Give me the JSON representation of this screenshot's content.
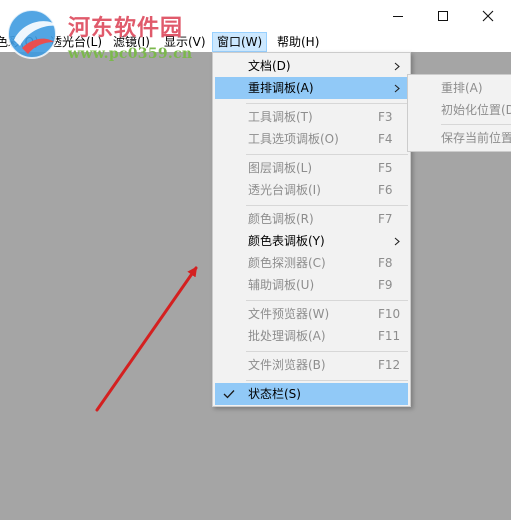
{
  "watermark": {
    "site_name": "河东软件园",
    "url": "www.pc0359.cn"
  },
  "window_controls": {
    "minimize_icon": "minimize-icon",
    "maximize_icon": "maximize-icon",
    "close_icon": "close-icon"
  },
  "menubar": {
    "items": [
      {
        "label": "色彩(O)"
      },
      {
        "label": "透光台(L)"
      },
      {
        "label": "滤镜(I)"
      },
      {
        "label": "显示(V)"
      },
      {
        "label": "窗口(W)"
      },
      {
        "label": "帮助(H)"
      }
    ]
  },
  "window_menu": {
    "items": [
      {
        "label": "文档(D)",
        "shortcut": "",
        "submenu": true,
        "enabled": true
      },
      {
        "label": "重排调板(A)",
        "shortcut": "",
        "submenu": true,
        "enabled": true,
        "highlighted": true
      },
      {
        "label": "工具调板(T)",
        "shortcut": "F3",
        "enabled": false
      },
      {
        "label": "工具选项调板(O)",
        "shortcut": "F4",
        "enabled": false
      },
      {
        "label": "图层调板(L)",
        "shortcut": "F5",
        "enabled": false
      },
      {
        "label": "透光台调板(I)",
        "shortcut": "F6",
        "enabled": false
      },
      {
        "label": "颜色调板(R)",
        "shortcut": "F7",
        "enabled": false
      },
      {
        "label": "颜色表调板(Y)",
        "shortcut": "",
        "submenu": true,
        "enabled": true
      },
      {
        "label": "颜色探测器(C)",
        "shortcut": "F8",
        "enabled": false
      },
      {
        "label": "辅助调板(U)",
        "shortcut": "F9",
        "enabled": false
      },
      {
        "label": "文件预览器(W)",
        "shortcut": "F10",
        "enabled": false
      },
      {
        "label": "批处理调板(A)",
        "shortcut": "F11",
        "enabled": false
      },
      {
        "label": "文件浏览器(B)",
        "shortcut": "F12",
        "enabled": false
      },
      {
        "label": "状态栏(S)",
        "shortcut": "",
        "enabled": true,
        "checked": true
      }
    ]
  },
  "arrange_submenu": {
    "items": [
      {
        "label": "重排(A)",
        "enabled": false
      },
      {
        "label": "初始化位置(D",
        "enabled": false
      },
      {
        "label": "保存当前位置",
        "enabled": false
      }
    ]
  },
  "annotation": {
    "color": "#d42020"
  }
}
